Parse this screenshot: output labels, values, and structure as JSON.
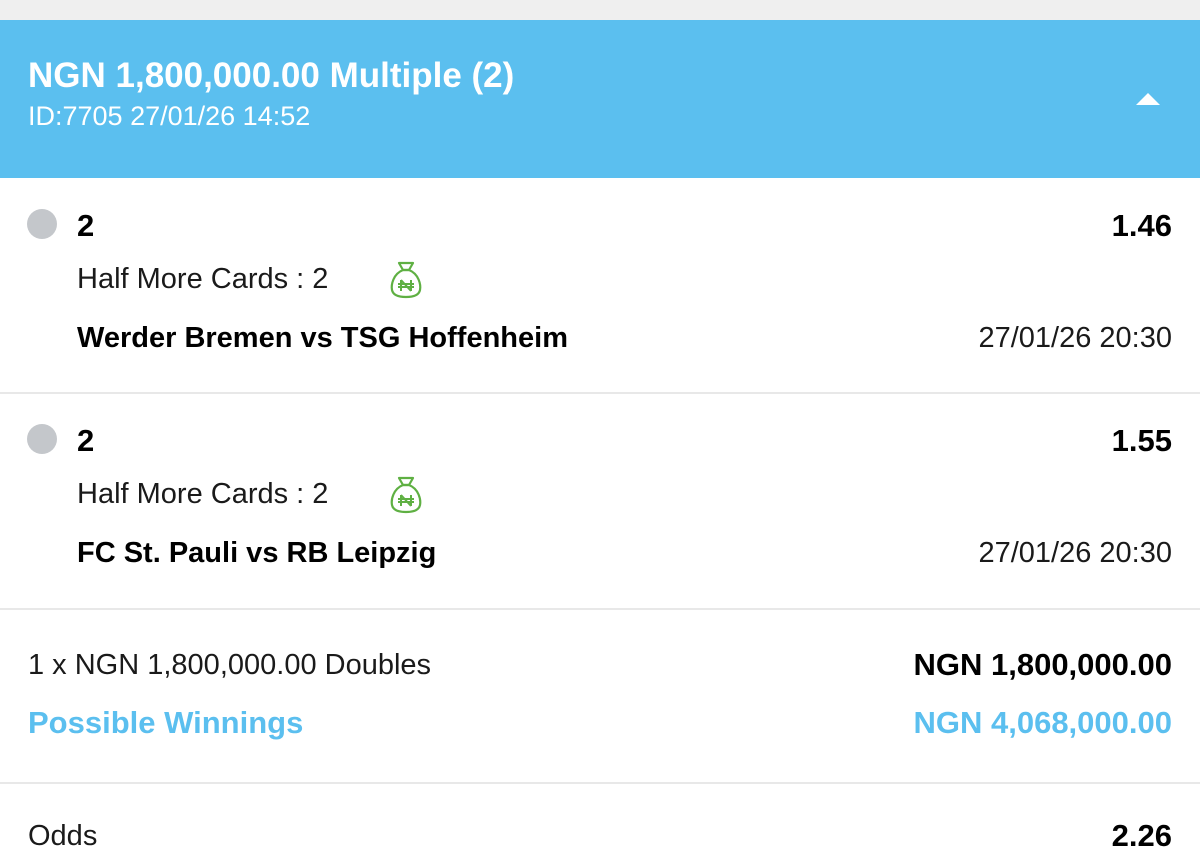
{
  "colors": {
    "accent": "#5bbfef",
    "status_pending": "#c4c7cb",
    "money_icon": "#5fb043",
    "divider": "#e8e8e8"
  },
  "header": {
    "title": "NGN 1,800,000.00 Multiple (2)",
    "subtitle": "ID:7705 27/01/26 14:52",
    "collapse_icon": "chevron-up-icon"
  },
  "selections": [
    {
      "pick": "2",
      "odds": "1.46",
      "market": "Half More Cards : 2",
      "teams": "Werder Bremen vs TSG Hoffenheim",
      "kickoff": "27/01/26 20:30",
      "icon": "money-bag-icon"
    },
    {
      "pick": "2",
      "odds": "1.55",
      "market": "Half More Cards : 2",
      "teams": "FC St. Pauli vs RB Leipzig",
      "kickoff": "27/01/26 20:30",
      "icon": "money-bag-icon"
    }
  ],
  "summary": {
    "stake_label": "1 x NGN 1,800,000.00 Doubles",
    "stake_value": "NGN 1,800,000.00",
    "winnings_label": "Possible Winnings",
    "winnings_value": "NGN 4,068,000.00"
  },
  "odds_row": {
    "label": "Odds",
    "value": "2.26"
  }
}
